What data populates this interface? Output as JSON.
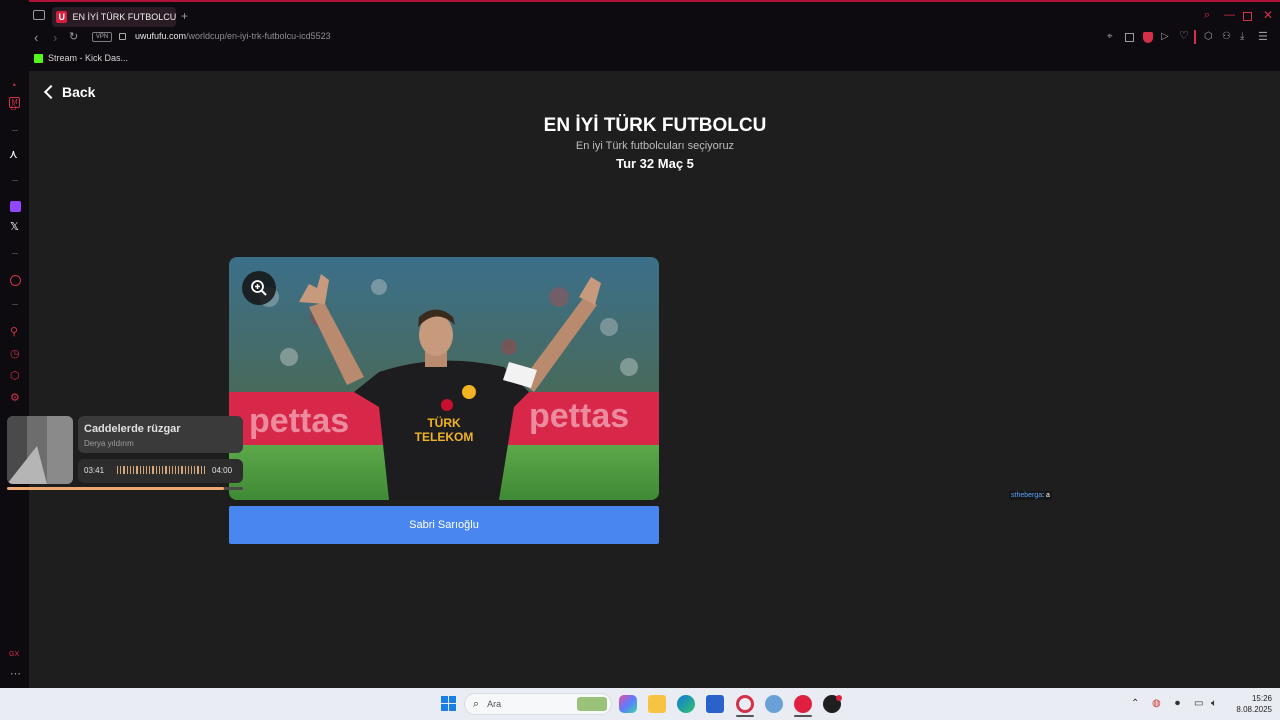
{
  "browser": {
    "tab_title": "EN İYİ TÜRK FUTBOLCU |",
    "tab_favicon": "U",
    "vpn_label": "VPN",
    "url_domain": "uwufufu.com",
    "url_path": "/worldcup/en-iyi-trk-futbolcu-icd5523",
    "bookmark_label": "Stream - Kick Das..."
  },
  "page": {
    "back_label": "Back",
    "title": "EN İYİ TÜRK FUTBOLCU",
    "subtitle": "En iyi Türk futbolcuları seçiyoruz",
    "round": "Tur 32 Maç 5",
    "choice_label": "Sabri Sarıoğlu",
    "jersey_text_1": "TÜRK",
    "jersey_text_2": "TELEKOM"
  },
  "music": {
    "title": "Caddelerde rüzgar",
    "artist": "Derya yıldırım",
    "current_time": "03:41",
    "total_time": "04:00",
    "progress": 0.92
  },
  "chat": {
    "user": "stheberga",
    "message": ": a"
  },
  "taskbar": {
    "search_placeholder": "Ara",
    "time": "15:26",
    "date": "8.08.2025"
  },
  "colors": {
    "accent_blue": "#4a86ef",
    "opera_red": "#d4304a",
    "page_bg": "#1e1e1e"
  }
}
